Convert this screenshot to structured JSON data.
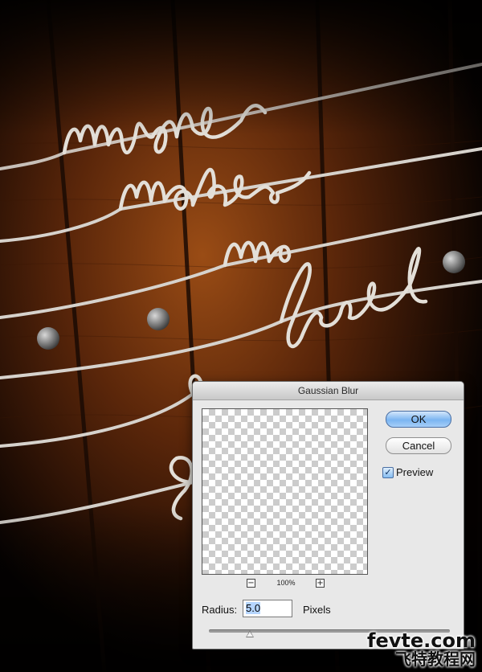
{
  "artwork": {
    "lettering": "music makes me feel",
    "accent_wood": "#6a2e0c",
    "string_color": "#d6d2cc"
  },
  "dialog": {
    "title": "Gaussian Blur",
    "ok_label": "OK",
    "cancel_label": "Cancel",
    "preview_label": "Preview",
    "preview_checked": true,
    "zoom_out_label": "−",
    "zoom_in_label": "+",
    "zoom_level": "100%",
    "radius_label": "Radius:",
    "radius_value": "5.0",
    "radius_unit": "Pixels",
    "slider_level": 0.17
  },
  "watermark": {
    "top": "fevte.com",
    "bottom": "飞特教程网"
  }
}
